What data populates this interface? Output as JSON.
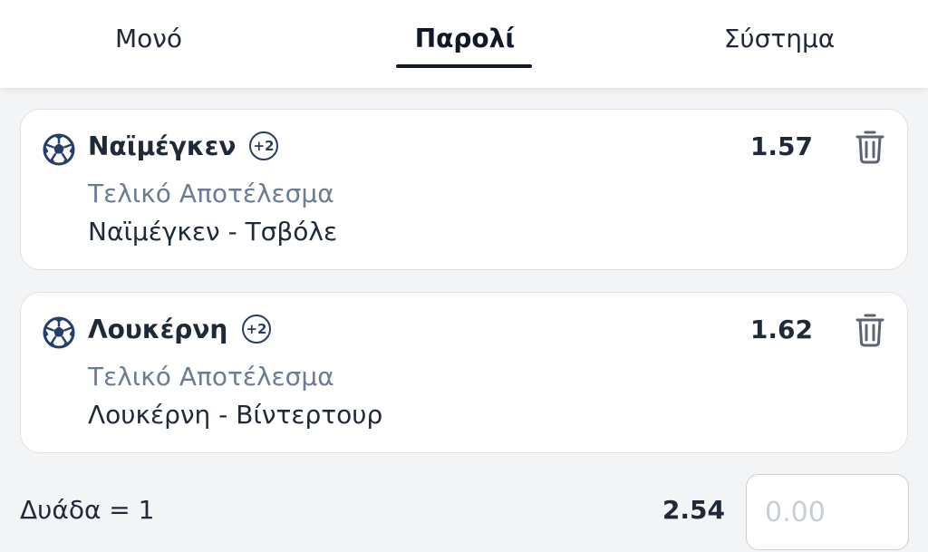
{
  "tabs": [
    {
      "label": "Μονό",
      "active": false
    },
    {
      "label": "Παρολί",
      "active": true
    },
    {
      "label": "Σύστημα",
      "active": false
    }
  ],
  "selections": [
    {
      "team": "Ναϊμέγκεν",
      "badge": "+2",
      "odds": "1.57",
      "market": "Τελικό Αποτέλεσμα",
      "match": "Ναϊμέγκεν - Τσβόλε",
      "icon": "soccer-ball-icon"
    },
    {
      "team": "Λουκέρνη",
      "badge": "+2",
      "odds": "1.62",
      "market": "Τελικό Αποτέλεσμα",
      "match": "Λουκέρνη - Βίντερτουρ",
      "icon": "soccer-ball-icon"
    }
  ],
  "footer": {
    "combo_label": "Δυάδα = 1",
    "total_odds": "2.54",
    "stake_placeholder": "0.00",
    "stake_value": ""
  },
  "colors": {
    "accent": "#111827",
    "badge": "#2a3f5f",
    "muted_text": "#6b7c93",
    "background": "#f3f4f6"
  }
}
